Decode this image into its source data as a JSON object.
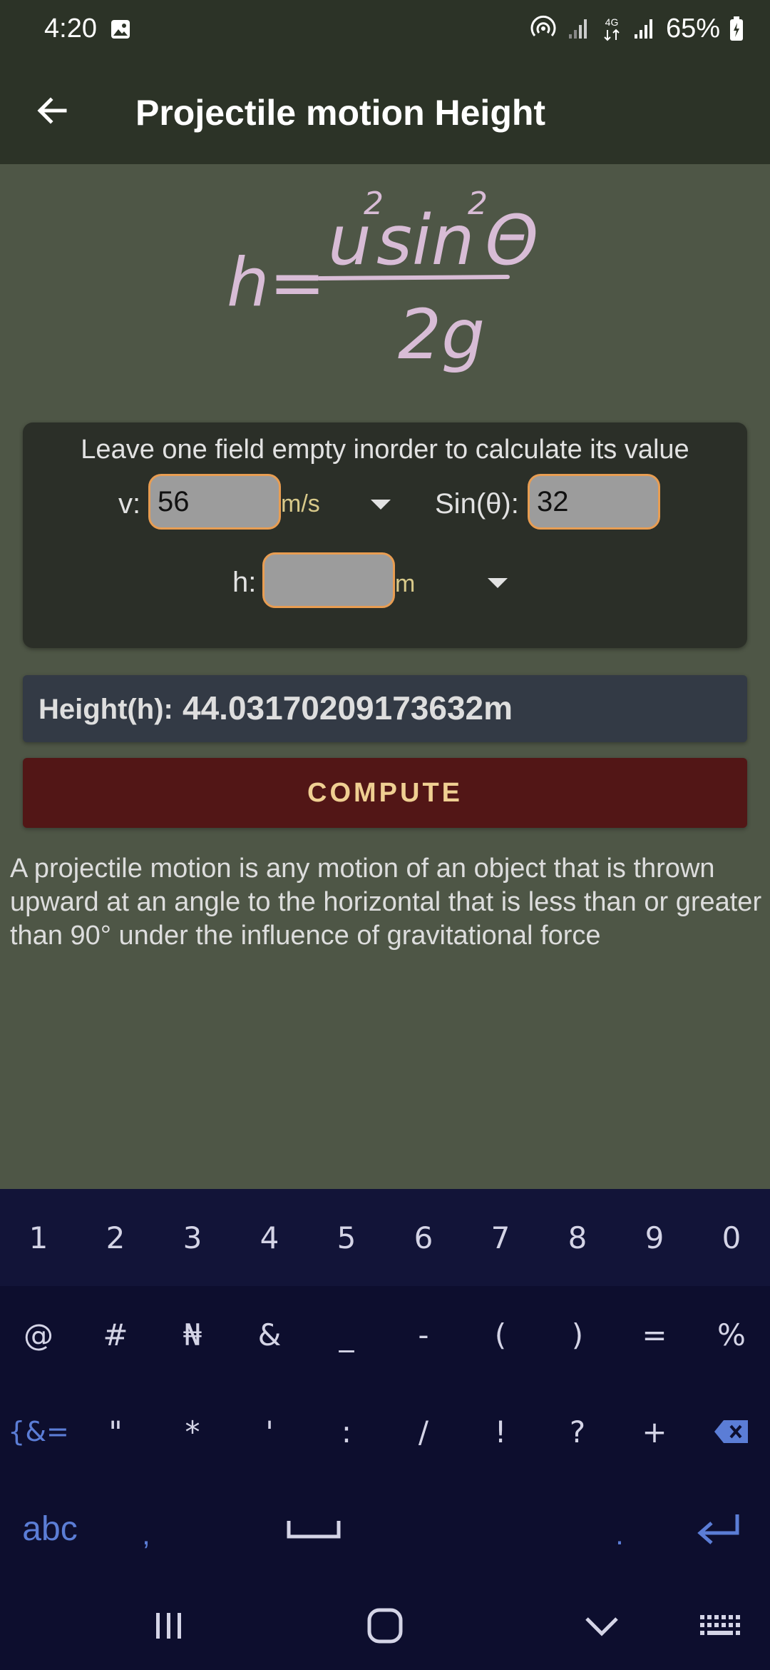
{
  "status_bar": {
    "time": "4:20",
    "battery": "65%",
    "network": "4G",
    "icons": [
      "image-icon",
      "hotspot-icon",
      "signal-icon",
      "data-4g-icon",
      "signal-icon",
      "battery-charging-icon"
    ]
  },
  "app_bar": {
    "title": "Projectile motion Height",
    "back_icon": "back-arrow-icon"
  },
  "formula": {
    "lhs": "h=",
    "u": "u",
    "u_exp": "2",
    "sin": "sin",
    "sin_exp": "2",
    "theta": "Θ",
    "denominator": "2g"
  },
  "form": {
    "hint": "Leave one field empty inorder to calculate its value",
    "v_label": "v:",
    "v_value": "56",
    "v_unit": "m/s",
    "sin_label": "Sin(θ):",
    "sin_value": "32",
    "h_label": "h:",
    "h_value": "",
    "h_unit": "m"
  },
  "result": {
    "label": "Height(h):",
    "value": "44.03170209173632m"
  },
  "compute_label": "COMPUTE",
  "description": "A projectile motion is any motion of an object that is thrown upward at an angle to the horizontal that is less than or greater than 90° under the influence of gravitational force",
  "keyboard": {
    "numbers": [
      "1",
      "2",
      "3",
      "4",
      "5",
      "6",
      "7",
      "8",
      "9",
      "0"
    ],
    "symbols_row1": [
      "@",
      "#",
      "₦",
      "&",
      "_",
      "-",
      "(",
      ")",
      "=",
      "%"
    ],
    "symbols_row2": [
      "{&=",
      "\"",
      "*",
      "'",
      ":",
      "/",
      "!",
      "?",
      "+"
    ],
    "abc": "abc",
    "comma": ",",
    "period": "."
  },
  "colors": {
    "background": "#4e5646",
    "app_bar": "#2c3327",
    "card": "#2b2f28",
    "field_border": "#e89d52",
    "result_bg": "#333a45",
    "compute_bg": "#521616",
    "compute_text": "#efcf92",
    "formula": "#d8bcd6",
    "keyboard_bg": "#0d0e2e",
    "keyboard_accent": "#5b7dd6"
  }
}
